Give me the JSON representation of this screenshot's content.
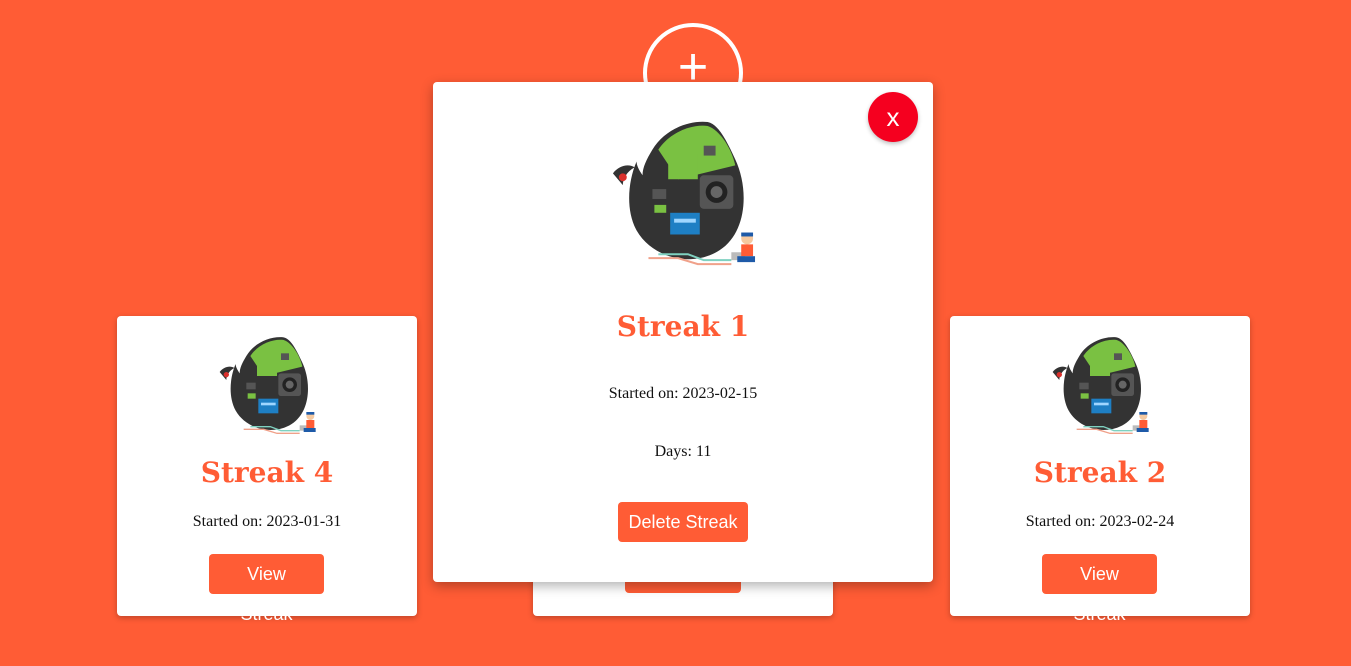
{
  "add_button": {
    "label": "+"
  },
  "cards": [
    {
      "title": "Streak 4",
      "started": "Started on: 2023-01-31",
      "button": "View Streak"
    },
    {
      "title": "Streak 2",
      "started": "Started on: 2023-02-24",
      "button": "View Streak"
    }
  ],
  "modal": {
    "close_label": "x",
    "title": "Streak 1",
    "started": "Started on: 2023-02-15",
    "days": "Days: 11",
    "delete_button": "Delete Streak"
  },
  "colors": {
    "background": "#ff5c35",
    "accent": "#ff5c35",
    "close": "#f5001f",
    "card": "#ffffff"
  },
  "icons": {
    "streak_image": "circuit-leaf-illustration"
  }
}
